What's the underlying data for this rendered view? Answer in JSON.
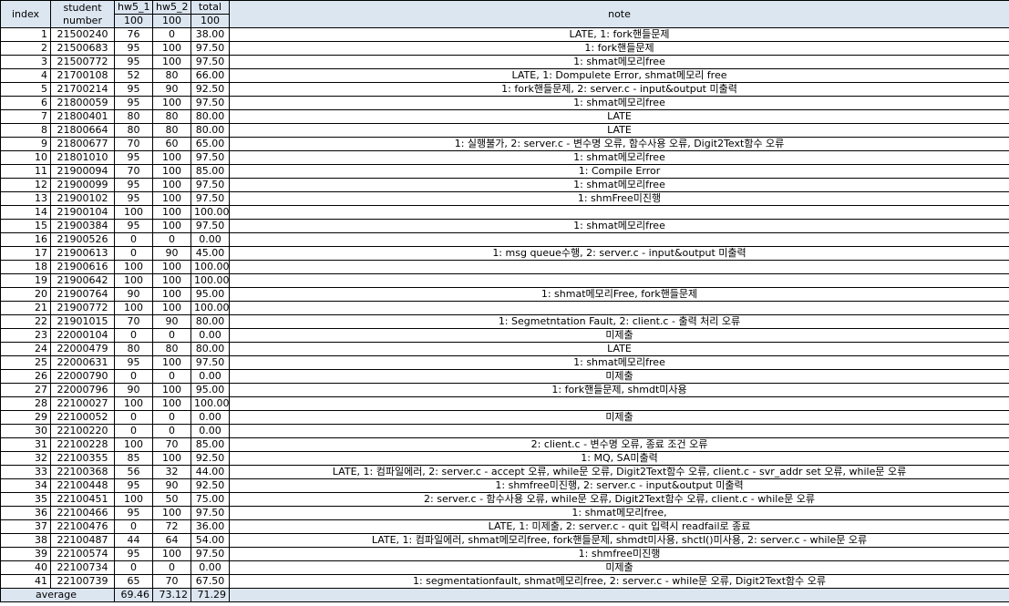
{
  "headers": {
    "index": "index",
    "student": "student number",
    "hw5_1": "hw5_1",
    "hw5_2": "hw5_2",
    "total": "total",
    "note": "note",
    "max_hw5_1": "100",
    "max_hw5_2": "100",
    "max_total": "100"
  },
  "rows": [
    {
      "index": "1",
      "student": "21500240",
      "hw5_1": "76",
      "hw5_2": "0",
      "total": "38.00",
      "note": "LATE, 1: fork핸들문제"
    },
    {
      "index": "2",
      "student": "21500683",
      "hw5_1": "95",
      "hw5_2": "100",
      "total": "97.50",
      "note": "1: fork핸들문제"
    },
    {
      "index": "3",
      "student": "21500772",
      "hw5_1": "95",
      "hw5_2": "100",
      "total": "97.50",
      "note": "1: shmat메모리free"
    },
    {
      "index": "4",
      "student": "21700108",
      "hw5_1": "52",
      "hw5_2": "80",
      "total": "66.00",
      "note": "LATE, 1: Dompulete Error, shmat메모리 free"
    },
    {
      "index": "5",
      "student": "21700214",
      "hw5_1": "95",
      "hw5_2": "90",
      "total": "92.50",
      "note": "1: fork핸들문제, 2: server.c - input&output 미출력"
    },
    {
      "index": "6",
      "student": "21800059",
      "hw5_1": "95",
      "hw5_2": "100",
      "total": "97.50",
      "note": "1: shmat메모리free"
    },
    {
      "index": "7",
      "student": "21800401",
      "hw5_1": "80",
      "hw5_2": "80",
      "total": "80.00",
      "note": "LATE"
    },
    {
      "index": "8",
      "student": "21800664",
      "hw5_1": "80",
      "hw5_2": "80",
      "total": "80.00",
      "note": "LATE"
    },
    {
      "index": "9",
      "student": "21800677",
      "hw5_1": "70",
      "hw5_2": "60",
      "total": "65.00",
      "note": "1: 실행불가, 2: server.c - 변수명 오류, 함수사용 오류, Digit2Text함수 오류"
    },
    {
      "index": "10",
      "student": "21801010",
      "hw5_1": "95",
      "hw5_2": "100",
      "total": "97.50",
      "note": "1: shmat메모리free"
    },
    {
      "index": "11",
      "student": "21900094",
      "hw5_1": "70",
      "hw5_2": "100",
      "total": "85.00",
      "note": "1: Compile Error"
    },
    {
      "index": "12",
      "student": "21900099",
      "hw5_1": "95",
      "hw5_2": "100",
      "total": "97.50",
      "note": "1: shmat메모리free"
    },
    {
      "index": "13",
      "student": "21900102",
      "hw5_1": "95",
      "hw5_2": "100",
      "total": "97.50",
      "note": "1: shmFree미진행"
    },
    {
      "index": "14",
      "student": "21900104",
      "hw5_1": "100",
      "hw5_2": "100",
      "total": "100.00",
      "note": ""
    },
    {
      "index": "15",
      "student": "21900384",
      "hw5_1": "95",
      "hw5_2": "100",
      "total": "97.50",
      "note": "1: shmat메모리free"
    },
    {
      "index": "16",
      "student": "21900526",
      "hw5_1": "0",
      "hw5_2": "0",
      "total": "0.00",
      "note": ""
    },
    {
      "index": "17",
      "student": "21900613",
      "hw5_1": "0",
      "hw5_2": "90",
      "total": "45.00",
      "note": "1: msg queue수행, 2: server.c - input&output 미출력"
    },
    {
      "index": "18",
      "student": "21900616",
      "hw5_1": "100",
      "hw5_2": "100",
      "total": "100.00",
      "note": ""
    },
    {
      "index": "19",
      "student": "21900642",
      "hw5_1": "100",
      "hw5_2": "100",
      "total": "100.00",
      "note": ""
    },
    {
      "index": "20",
      "student": "21900764",
      "hw5_1": "90",
      "hw5_2": "100",
      "total": "95.00",
      "note": "1: shmat메모리Free, fork핸들문제"
    },
    {
      "index": "21",
      "student": "21900772",
      "hw5_1": "100",
      "hw5_2": "100",
      "total": "100.00",
      "note": ""
    },
    {
      "index": "22",
      "student": "21901015",
      "hw5_1": "70",
      "hw5_2": "90",
      "total": "80.00",
      "note": "1: Segmetntation Fault, 2: client.c - 출력 처리 오류"
    },
    {
      "index": "23",
      "student": "22000104",
      "hw5_1": "0",
      "hw5_2": "0",
      "total": "0.00",
      "note": "미제출"
    },
    {
      "index": "24",
      "student": "22000479",
      "hw5_1": "80",
      "hw5_2": "80",
      "total": "80.00",
      "note": "LATE"
    },
    {
      "index": "25",
      "student": "22000631",
      "hw5_1": "95",
      "hw5_2": "100",
      "total": "97.50",
      "note": "1: shmat메모리free"
    },
    {
      "index": "26",
      "student": "22000790",
      "hw5_1": "0",
      "hw5_2": "0",
      "total": "0.00",
      "note": "미제출"
    },
    {
      "index": "27",
      "student": "22000796",
      "hw5_1": "90",
      "hw5_2": "100",
      "total": "95.00",
      "note": "1: fork핸들문제, shmdt미사용"
    },
    {
      "index": "28",
      "student": "22100027",
      "hw5_1": "100",
      "hw5_2": "100",
      "total": "100.00",
      "note": ""
    },
    {
      "index": "29",
      "student": "22100052",
      "hw5_1": "0",
      "hw5_2": "0",
      "total": "0.00",
      "note": "미제출"
    },
    {
      "index": "30",
      "student": "22100220",
      "hw5_1": "0",
      "hw5_2": "0",
      "total": "0.00",
      "note": ""
    },
    {
      "index": "31",
      "student": "22100228",
      "hw5_1": "100",
      "hw5_2": "70",
      "total": "85.00",
      "note": "2: client.c - 변수명 오류, 종료 조건 오류"
    },
    {
      "index": "32",
      "student": "22100355",
      "hw5_1": "85",
      "hw5_2": "100",
      "total": "92.50",
      "note": "1: MQ, SA미출력"
    },
    {
      "index": "33",
      "student": "22100368",
      "hw5_1": "56",
      "hw5_2": "32",
      "total": "44.00",
      "note": "LATE, 1: 컴파일에러, 2: server.c - accept 오류, while문 오류, Digit2Text함수 오류, client.c - svr_addr set 오류, while문 오류"
    },
    {
      "index": "34",
      "student": "22100448",
      "hw5_1": "95",
      "hw5_2": "90",
      "total": "92.50",
      "note": "1: shmfree미진행, 2: server.c - input&output 미출력"
    },
    {
      "index": "35",
      "student": "22100451",
      "hw5_1": "100",
      "hw5_2": "50",
      "total": "75.00",
      "note": "2: server.c - 함수사용 오류, while문 오류, Digit2Text함수 오류, client.c - while문 오류"
    },
    {
      "index": "36",
      "student": "22100466",
      "hw5_1": "95",
      "hw5_2": "100",
      "total": "97.50",
      "note": "1: shmat메모리free,"
    },
    {
      "index": "37",
      "student": "22100476",
      "hw5_1": "0",
      "hw5_2": "72",
      "total": "36.00",
      "note": "LATE, 1: 미제출, 2: server.c - quit 입력시 readfail로 종료"
    },
    {
      "index": "38",
      "student": "22100487",
      "hw5_1": "44",
      "hw5_2": "64",
      "total": "54.00",
      "note": "LATE, 1: 컴파일에러, shmat메모리free, fork핸들문제, shmdt미사용, shctl()미사용, 2: server.c - while문 오류"
    },
    {
      "index": "39",
      "student": "22100574",
      "hw5_1": "95",
      "hw5_2": "100",
      "total": "97.50",
      "note": "1: shmfree미진행"
    },
    {
      "index": "40",
      "student": "22100734",
      "hw5_1": "0",
      "hw5_2": "0",
      "total": "0.00",
      "note": "미제출"
    },
    {
      "index": "41",
      "student": "22100739",
      "hw5_1": "65",
      "hw5_2": "70",
      "total": "67.50",
      "note": "1: segmentationfault, shmat메모리free, 2: server.c - while문 오류, Digit2Text함수 오류"
    }
  ],
  "footer": {
    "label": "average",
    "hw5_1": "69.46",
    "hw5_2": "73.12",
    "total": "71.29"
  }
}
